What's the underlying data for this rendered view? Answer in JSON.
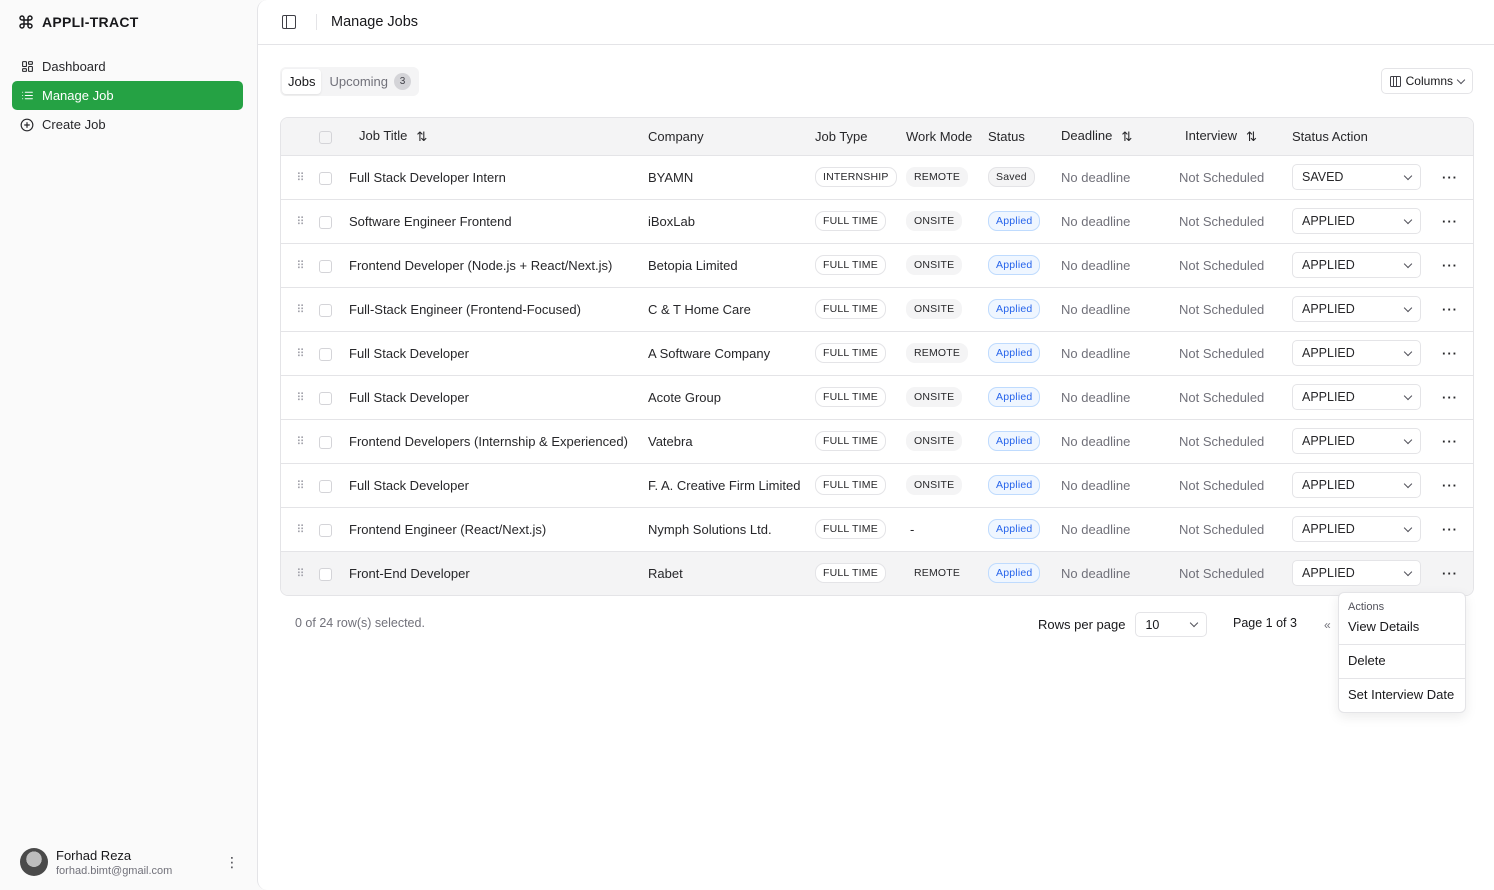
{
  "brand": {
    "name": "APPLI-TRACT"
  },
  "nav": [
    {
      "label": "Dashboard",
      "icon": "dashboard-icon"
    },
    {
      "label": "Manage Job",
      "icon": "list-icon",
      "active": true
    },
    {
      "label": "Create Job",
      "icon": "plus-circle-icon"
    }
  ],
  "user": {
    "name": "Forhad Reza",
    "email": "forhad.bimt@gmail.com"
  },
  "header": {
    "title": "Manage Jobs"
  },
  "tabs": [
    {
      "label": "Jobs",
      "active": true
    },
    {
      "label": "Upcoming",
      "badge": "3"
    }
  ],
  "columns_button": {
    "label": "Columns"
  },
  "table": {
    "headers": {
      "job_title": "Job Title",
      "company": "Company",
      "job_type": "Job Type",
      "work_mode": "Work Mode",
      "status": "Status",
      "deadline": "Deadline",
      "interview": "Interview",
      "status_action": "Status Action"
    },
    "rows": [
      {
        "job_title": "Full Stack Developer Intern",
        "company": "BYAMN",
        "job_type": "INTERNSHIP",
        "work_mode": "REMOTE",
        "status": "Saved",
        "deadline": "No deadline",
        "interview": "Not Scheduled",
        "status_action": "SAVED"
      },
      {
        "job_title": "Software Engineer Frontend",
        "company": "iBoxLab",
        "job_type": "FULL TIME",
        "work_mode": "ONSITE",
        "status": "Applied",
        "deadline": "No deadline",
        "interview": "Not Scheduled",
        "status_action": "APPLIED"
      },
      {
        "job_title": "Frontend Developer (Node.js + React/Next.js)",
        "company": "Betopia Limited",
        "job_type": "FULL TIME",
        "work_mode": "ONSITE",
        "status": "Applied",
        "deadline": "No deadline",
        "interview": "Not Scheduled",
        "status_action": "APPLIED"
      },
      {
        "job_title": "Full-Stack Engineer (Frontend-Focused)",
        "company": "C & T Home Care",
        "job_type": "FULL TIME",
        "work_mode": "ONSITE",
        "status": "Applied",
        "deadline": "No deadline",
        "interview": "Not Scheduled",
        "status_action": "APPLIED"
      },
      {
        "job_title": "Full Stack Developer",
        "company": "A Software Company",
        "job_type": "FULL TIME",
        "work_mode": "REMOTE",
        "status": "Applied",
        "deadline": "No deadline",
        "interview": "Not Scheduled",
        "status_action": "APPLIED"
      },
      {
        "job_title": "Full Stack Developer",
        "company": "Acote Group",
        "job_type": "FULL TIME",
        "work_mode": "ONSITE",
        "status": "Applied",
        "deadline": "No deadline",
        "interview": "Not Scheduled",
        "status_action": "APPLIED"
      },
      {
        "job_title": "Frontend Developers (Internship & Experienced)",
        "company": "Vatebra",
        "job_type": "FULL TIME",
        "work_mode": "ONSITE",
        "status": "Applied",
        "deadline": "No deadline",
        "interview": "Not Scheduled",
        "status_action": "APPLIED"
      },
      {
        "job_title": "Full Stack Developer",
        "company": "F. A. Creative Firm Limited",
        "job_type": "FULL TIME",
        "work_mode": "ONSITE",
        "status": "Applied",
        "deadline": "No deadline",
        "interview": "Not Scheduled",
        "status_action": "APPLIED"
      },
      {
        "job_title": "Frontend Engineer (React/Next.js)",
        "company": "Nymph Solutions Ltd.",
        "job_type": "FULL TIME",
        "work_mode": "-",
        "status": "Applied",
        "deadline": "No deadline",
        "interview": "Not Scheduled",
        "status_action": "APPLIED"
      },
      {
        "job_title": "Front-End Developer",
        "company": "Rabet",
        "job_type": "FULL TIME",
        "work_mode": "REMOTE",
        "status": "Applied",
        "deadline": "No deadline",
        "interview": "Not Scheduled",
        "status_action": "APPLIED"
      }
    ]
  },
  "footer": {
    "selected": "0 of 24 row(s) selected.",
    "rows_per_page_label": "Rows per page",
    "rows_per_page_value": "10",
    "page_info": "Page 1 of 3",
    "first_page": "«"
  },
  "menu": {
    "label": "Actions",
    "items": [
      "View Details",
      "Delete",
      "Set Interview Date"
    ]
  },
  "colors": {
    "accent": "#25a244",
    "applied": "#2563eb"
  }
}
